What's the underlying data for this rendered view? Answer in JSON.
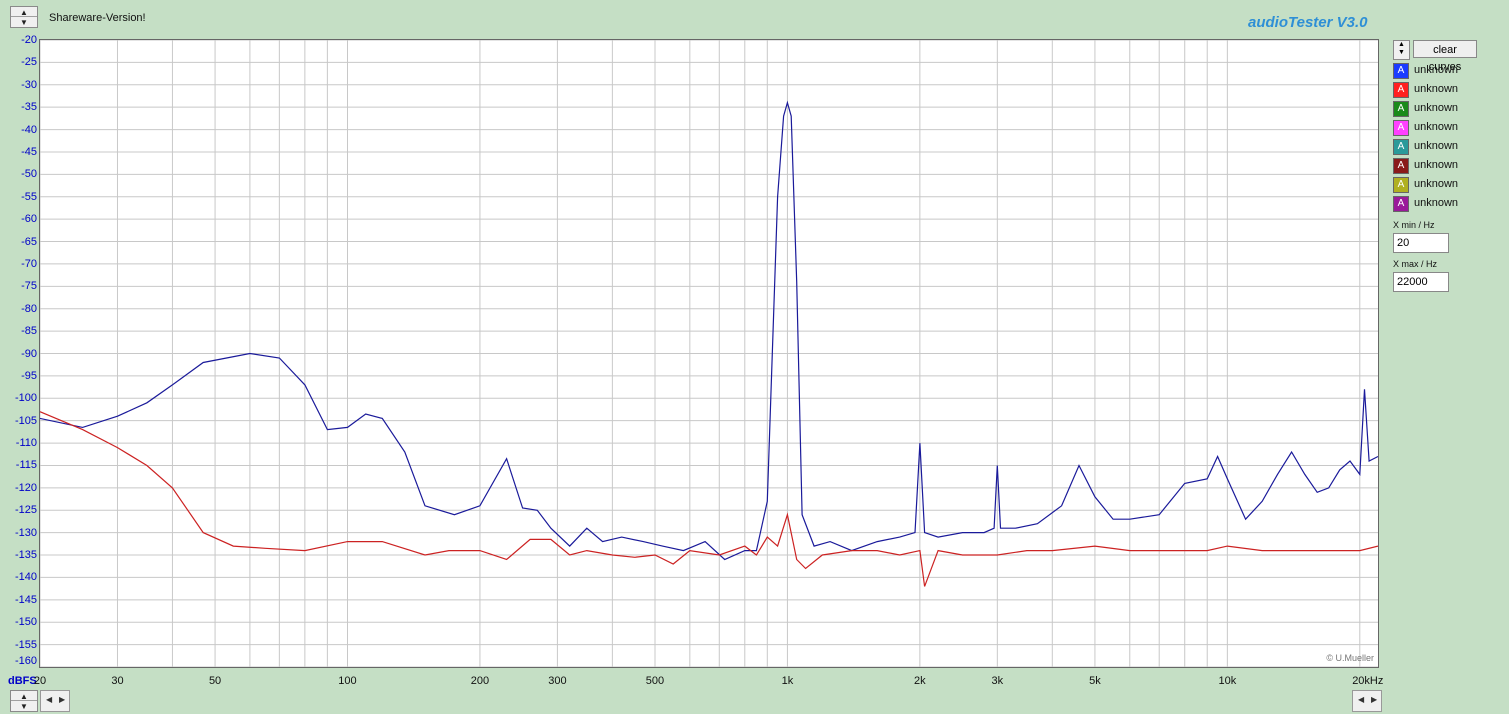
{
  "header": {
    "shareware": "Shareware-Version!",
    "brand": "audioTester  V3.0"
  },
  "plot": {
    "y_unit": "dBFS",
    "y_ticks": [
      "-20",
      "-25",
      "-30",
      "-35",
      "-40",
      "-45",
      "-50",
      "-55",
      "-60",
      "-65",
      "-70",
      "-75",
      "-80",
      "-85",
      "-90",
      "-95",
      "-100",
      "-105",
      "-110",
      "-115",
      "-120",
      "-125",
      "-130",
      "-135",
      "-140",
      "-145",
      "-150",
      "-155",
      "-160"
    ],
    "x_ticks": [
      "20",
      "30",
      "50",
      "100",
      "200",
      "300",
      "500",
      "1k",
      "2k",
      "3k",
      "5k",
      "10k",
      "20kHz"
    ],
    "copyright": "© U.Mueller"
  },
  "panel": {
    "clear_label": "clear curves",
    "curve_icon": "A",
    "curves": [
      {
        "label": "unknown",
        "color": "#1a3cff"
      },
      {
        "label": "unknown",
        "color": "#ff2020"
      },
      {
        "label": "unknown",
        "color": "#1a8a1a"
      },
      {
        "label": "unknown",
        "color": "#ff40ff"
      },
      {
        "label": "unknown",
        "color": "#2a9a9a"
      },
      {
        "label": "unknown",
        "color": "#8a1a1a"
      },
      {
        "label": "unknown",
        "color": "#b0b020"
      },
      {
        "label": "unknown",
        "color": "#9a1a9a"
      }
    ],
    "xmin_label": "X min / Hz",
    "xmin_value": "20",
    "xmax_label": "X max / Hz",
    "xmax_value": "22000"
  },
  "chart_data": {
    "type": "line",
    "xscale": "log",
    "xlim": [
      20,
      22000
    ],
    "ylim": [
      -160,
      -20
    ],
    "grid": true,
    "series": [
      {
        "color": "#1a1a9a",
        "x": [
          20,
          25,
          30,
          35,
          40,
          47,
          60,
          70,
          80,
          90,
          100,
          110,
          120,
          135,
          150,
          175,
          200,
          230,
          250,
          270,
          290,
          320,
          350,
          380,
          420,
          470,
          520,
          580,
          650,
          720,
          800,
          850,
          900,
          950,
          980,
          1000,
          1020,
          1050,
          1080,
          1150,
          1250,
          1400,
          1600,
          1800,
          1950,
          2000,
          2050,
          2200,
          2500,
          2800,
          2950,
          3000,
          3050,
          3300,
          3700,
          4200,
          4600,
          5000,
          5500,
          6000,
          7000,
          8000,
          9000,
          9500,
          10000,
          11000,
          12000,
          13000,
          14000,
          15000,
          16000,
          17000,
          18000,
          19000,
          20000,
          20500,
          21000,
          22000
        ],
        "y": [
          -104.5,
          -106.5,
          -104,
          -101,
          -97,
          -92,
          -90,
          -91,
          -97,
          -107,
          -106.5,
          -103.5,
          -104.5,
          -112,
          -124,
          -126,
          -124,
          -113.5,
          -124.5,
          -125,
          -129,
          -133,
          -129,
          -132,
          -131,
          -132,
          -133,
          -134,
          -132,
          -136,
          -134,
          -134,
          -123,
          -55,
          -37,
          -34,
          -37,
          -74,
          -126,
          -133,
          -132,
          -134,
          -132,
          -131,
          -130,
          -110,
          -130,
          -131,
          -130,
          -130,
          -129,
          -115,
          -129,
          -129,
          -128,
          -124,
          -115,
          -122,
          -127,
          -127,
          -126,
          -119,
          -118,
          -113,
          -118,
          -127,
          -123,
          -117,
          -112,
          -117,
          -121,
          -120,
          -116,
          -114,
          -117,
          -98,
          -114,
          -113
        ]
      },
      {
        "color": "#cc2222",
        "x": [
          20,
          25,
          30,
          35,
          40,
          47,
          55,
          65,
          80,
          100,
          120,
          150,
          170,
          200,
          230,
          260,
          290,
          320,
          350,
          400,
          450,
          500,
          550,
          600,
          700,
          800,
          850,
          900,
          950,
          1000,
          1050,
          1100,
          1200,
          1400,
          1600,
          1800,
          2000,
          2050,
          2200,
          2500,
          3000,
          3500,
          4000,
          5000,
          6000,
          7000,
          8000,
          9000,
          10000,
          12000,
          14000,
          16000,
          18000,
          20000,
          22000
        ],
        "y": [
          -103,
          -107,
          -111,
          -115,
          -120,
          -130,
          -133,
          -133.5,
          -134,
          -132,
          -132,
          -135,
          -134,
          -134,
          -136,
          -131.5,
          -131.5,
          -135,
          -134,
          -135,
          -135.5,
          -135,
          -137,
          -134,
          -135,
          -133,
          -135,
          -131,
          -133,
          -126,
          -136,
          -138,
          -135,
          -134,
          -134,
          -135,
          -134,
          -142,
          -134,
          -135,
          -135,
          -134,
          -134,
          -133,
          -134,
          -134,
          -134,
          -134,
          -133,
          -134,
          -134,
          -134,
          -134,
          -134,
          -133
        ]
      }
    ]
  }
}
